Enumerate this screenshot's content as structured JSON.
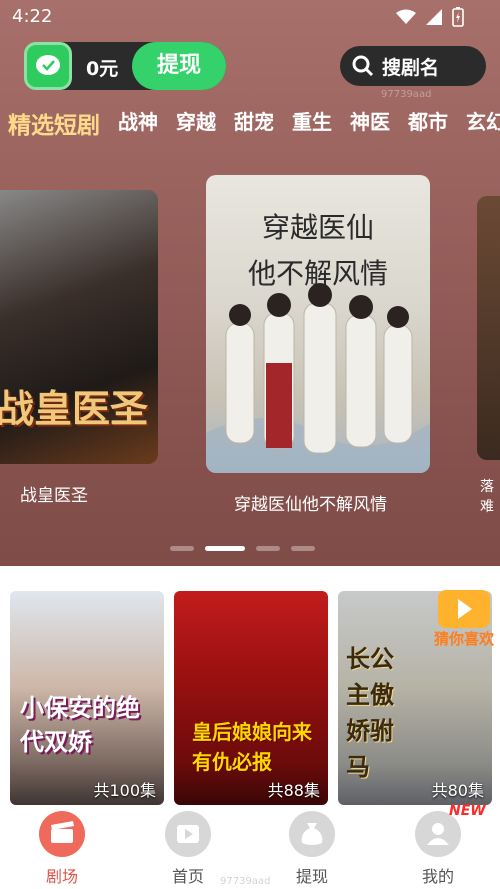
{
  "status_bar": {
    "time": "4:22"
  },
  "wallet": {
    "amount": "0元",
    "withdraw_label": "提现"
  },
  "search": {
    "label": "搜剧名"
  },
  "watermark": "97739aad",
  "tabs": [
    "精选短剧",
    "战神",
    "穿越",
    "甜宠",
    "重生",
    "神医",
    "都市",
    "玄幻"
  ],
  "carousel": {
    "left": {
      "poster_text": "战皇医圣",
      "caption": "战皇医圣"
    },
    "center": {
      "poster_text_line1": "穿越医仙",
      "poster_text_line2": "他不解风情",
      "caption": "穿越医仙他不解风情"
    },
    "right": {
      "caption": "落难"
    }
  },
  "dramas": [
    {
      "poster_text": "小保安的绝代双娇",
      "episodes": "共100集"
    },
    {
      "poster_text": "皇后娘娘向来有仇必报",
      "episodes": "共88集"
    },
    {
      "poster_text": "长公主傲娇驸马",
      "episodes": "共80集"
    }
  ],
  "guess": {
    "label": "猜你喜欢"
  },
  "nav": [
    {
      "label": "剧场",
      "active": true
    },
    {
      "label": "首页",
      "active": false
    },
    {
      "label": "提现",
      "active": false
    },
    {
      "label": "我的",
      "active": false
    }
  ],
  "nav_badge": "NEW",
  "colors": {
    "accent": "#35d16a",
    "active_tab": "#ffd98a",
    "nav_active": "#e0544a"
  }
}
